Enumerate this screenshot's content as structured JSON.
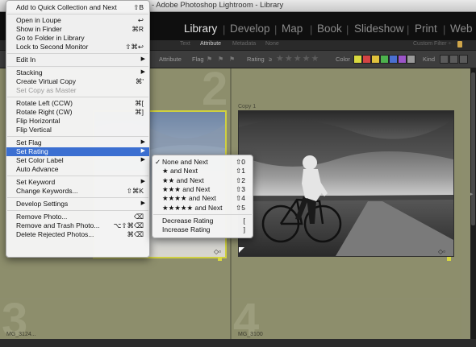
{
  "window": {
    "title": "st - Adobe Photoshop Lightroom - Library"
  },
  "modules": [
    "Library",
    "Develop",
    "Map",
    "Book",
    "Slideshow",
    "Print",
    "Web"
  ],
  "filter_bar": {
    "tabs": [
      "Text",
      "Attribute",
      "Metadata",
      "None"
    ],
    "custom_filter": "Custom Filter ÷",
    "attribute_label": "Attribute",
    "flag_label": "Flag",
    "rating_label": "Rating",
    "rating_op": "≥",
    "rating_stars": "★★★★★",
    "color_label": "Color",
    "colors": [
      "#d9d93f",
      "#d44444",
      "#e0c23c",
      "#4db24d",
      "#4a6fd1",
      "#9b54c7",
      "#9a9a9a"
    ],
    "kind_label": "Kind"
  },
  "grid": {
    "cells": [
      {
        "number": "2",
        "caption": ""
      },
      {
        "number": "",
        "caption": "Copy 1"
      },
      {
        "number": "3",
        "caption": "MG_3124..."
      },
      {
        "number": "4",
        "caption": "MG_3100"
      }
    ]
  },
  "context_menu": {
    "items": [
      {
        "label": "Add to Quick Collection and Next",
        "shortcut": "⇧B",
        "submenu": false,
        "disabled": false
      },
      {
        "sep": true
      },
      {
        "label": "Open in Loupe",
        "shortcut": "↩",
        "submenu": false,
        "disabled": false
      },
      {
        "label": "Show in Finder",
        "shortcut": "⌘R",
        "submenu": false,
        "disabled": false
      },
      {
        "label": "Go to Folder in Library",
        "shortcut": "",
        "submenu": false,
        "disabled": false
      },
      {
        "label": "Lock to Second Monitor",
        "shortcut": "⇧⌘↩",
        "submenu": false,
        "disabled": false
      },
      {
        "sep": true
      },
      {
        "label": "Edit In",
        "shortcut": "",
        "submenu": true,
        "disabled": false
      },
      {
        "sep": true
      },
      {
        "label": "Stacking",
        "shortcut": "",
        "submenu": true,
        "disabled": false
      },
      {
        "label": "Create Virtual Copy",
        "shortcut": "⌘'",
        "submenu": false,
        "disabled": false
      },
      {
        "label": "Set Copy as Master",
        "shortcut": "",
        "submenu": false,
        "disabled": true
      },
      {
        "sep": true
      },
      {
        "label": "Rotate Left (CCW)",
        "shortcut": "⌘[",
        "submenu": false,
        "disabled": false
      },
      {
        "label": "Rotate Right (CW)",
        "shortcut": "⌘]",
        "submenu": false,
        "disabled": false
      },
      {
        "label": "Flip Horizontal",
        "shortcut": "",
        "submenu": false,
        "disabled": false
      },
      {
        "label": "Flip Vertical",
        "shortcut": "",
        "submenu": false,
        "disabled": false
      },
      {
        "sep": true
      },
      {
        "label": "Set Flag",
        "shortcut": "",
        "submenu": true,
        "disabled": false
      },
      {
        "label": "Set Rating",
        "shortcut": "",
        "submenu": true,
        "disabled": false,
        "selected": true
      },
      {
        "label": "Set Color Label",
        "shortcut": "",
        "submenu": true,
        "disabled": false
      },
      {
        "label": "Auto Advance",
        "shortcut": "",
        "submenu": false,
        "disabled": false
      },
      {
        "sep": true
      },
      {
        "label": "Set Keyword",
        "shortcut": "",
        "submenu": true,
        "disabled": false
      },
      {
        "label": "Change Keywords...",
        "shortcut": "⇧⌘K",
        "submenu": false,
        "disabled": false
      },
      {
        "sep": true
      },
      {
        "label": "Develop Settings",
        "shortcut": "",
        "submenu": true,
        "disabled": false
      },
      {
        "sep": true
      },
      {
        "label": "Remove Photo...",
        "shortcut": "⌫",
        "submenu": false,
        "disabled": false
      },
      {
        "label": "Remove and Trash Photo...",
        "shortcut": "⌥⇧⌘⌫",
        "submenu": false,
        "disabled": false
      },
      {
        "label": "Delete Rejected Photos...",
        "shortcut": "⌘⌫",
        "submenu": false,
        "disabled": false
      }
    ]
  },
  "rating_submenu": {
    "items": [
      {
        "label": "None and Next",
        "shortcut": "⇧0",
        "checked": true
      },
      {
        "label": "★ and Next",
        "shortcut": "⇧1"
      },
      {
        "label": "★★ and Next",
        "shortcut": "⇧2"
      },
      {
        "label": "★★★ and Next",
        "shortcut": "⇧3"
      },
      {
        "label": "★★★★ and Next",
        "shortcut": "⇧4"
      },
      {
        "label": "★★★★★ and Next",
        "shortcut": "⇧5"
      },
      {
        "sep": true
      },
      {
        "label": "Decrease Rating",
        "shortcut": "["
      },
      {
        "label": "Increase Rating",
        "shortcut": "]"
      }
    ]
  }
}
